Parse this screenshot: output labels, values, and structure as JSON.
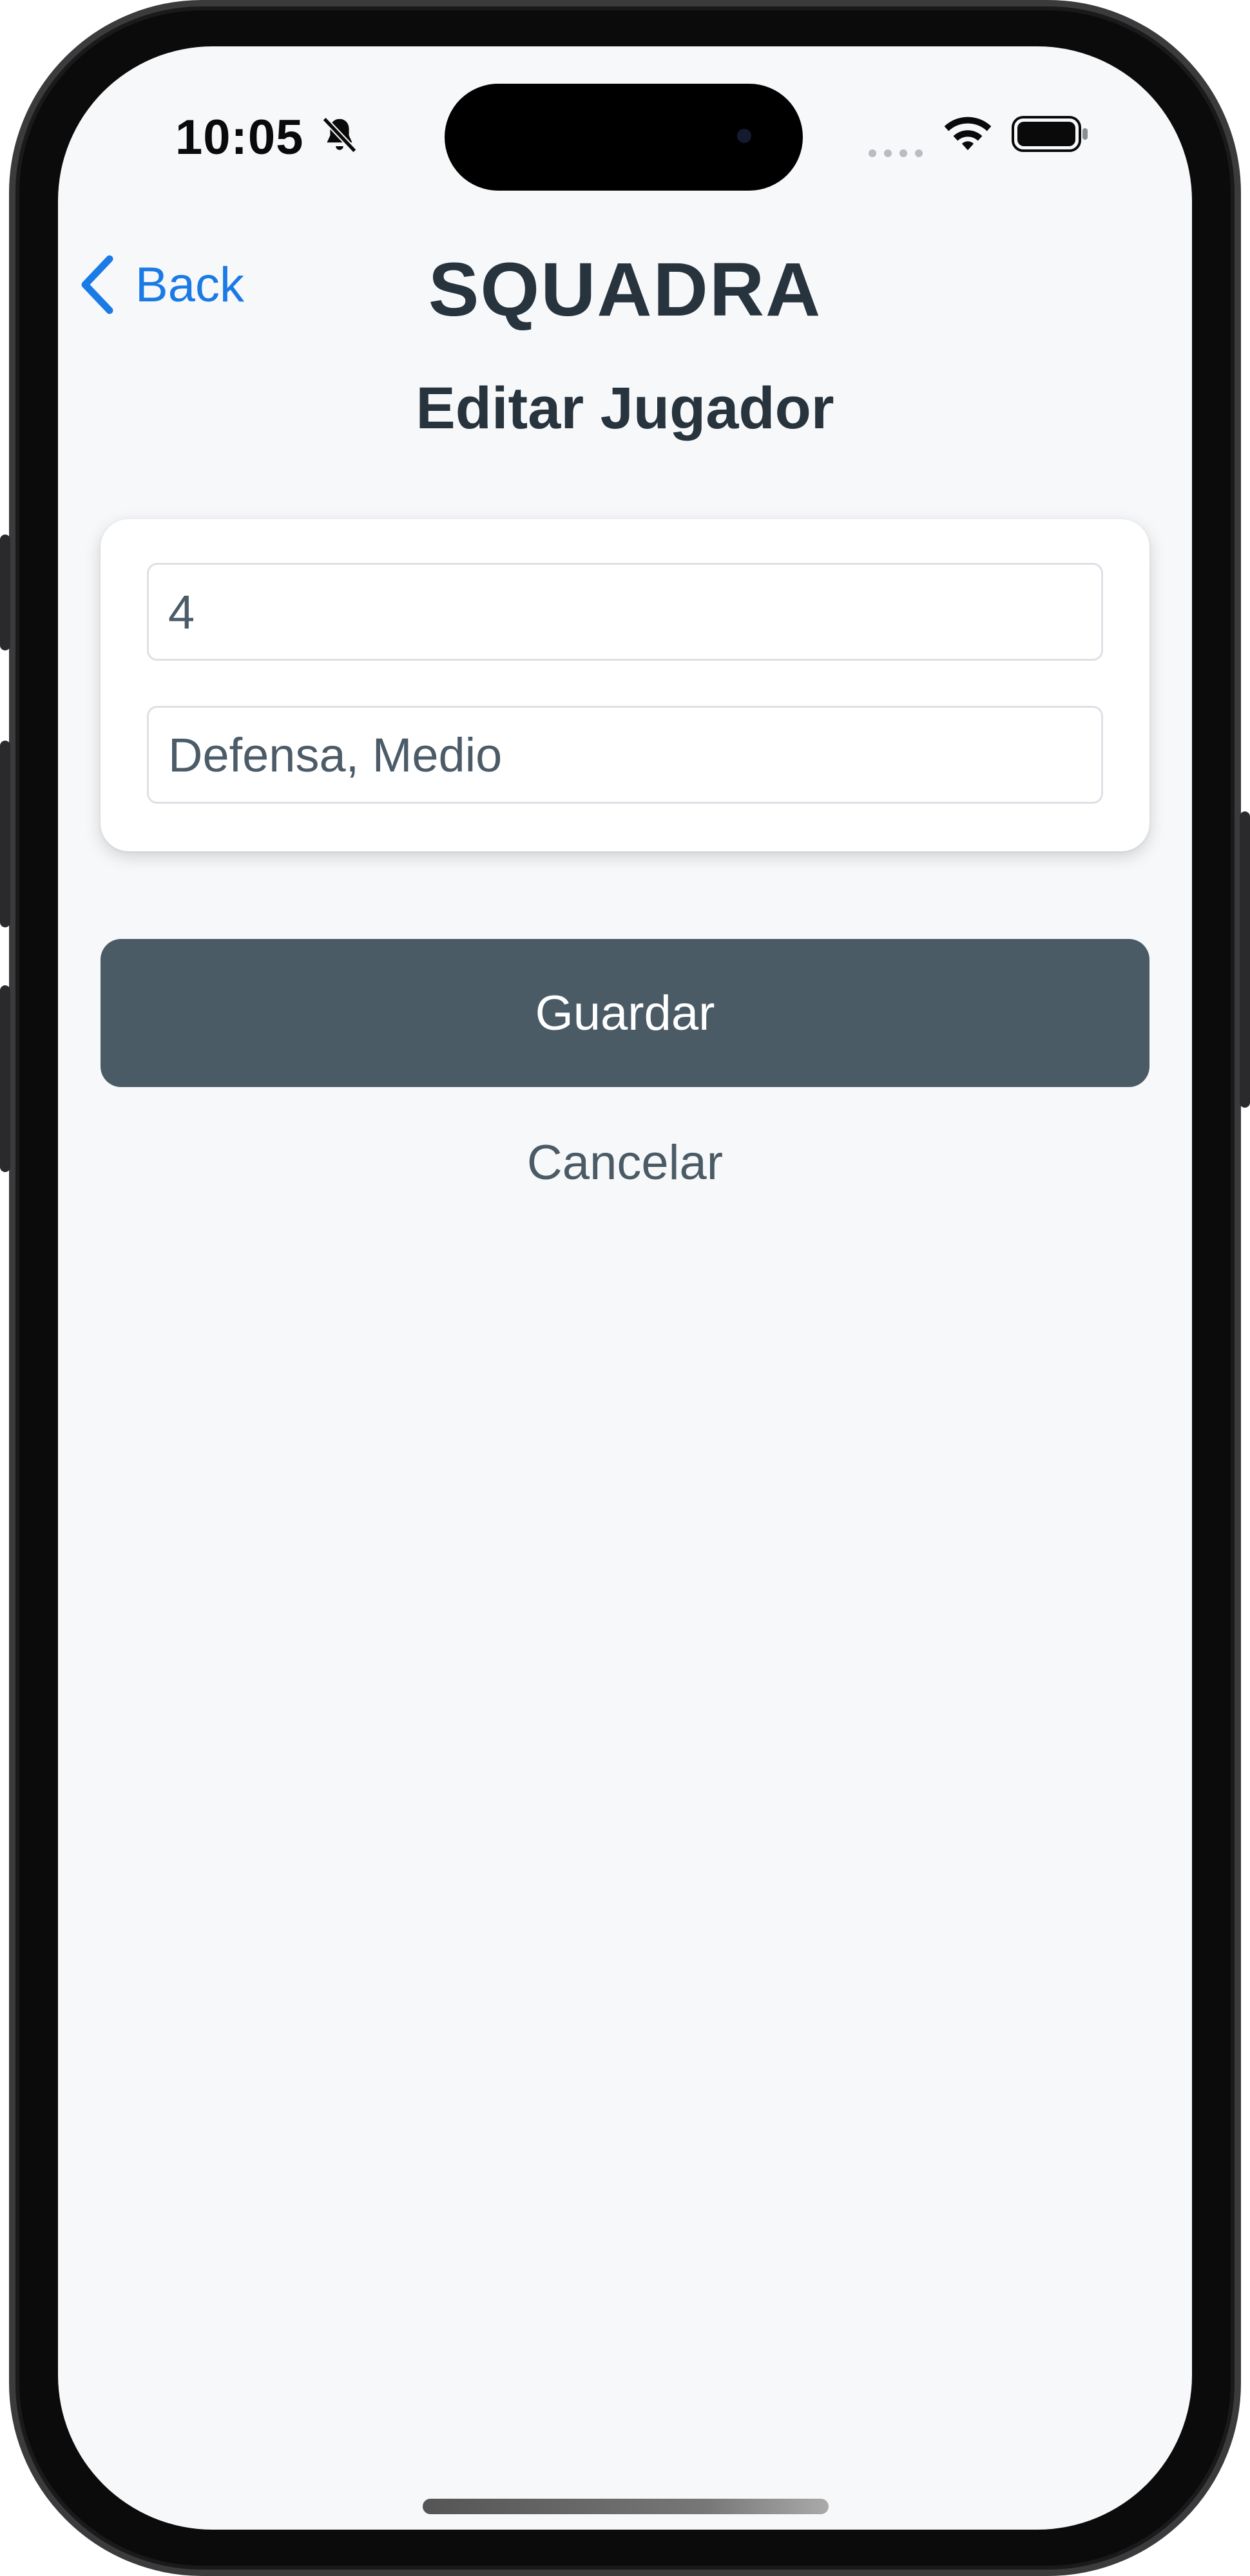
{
  "status_bar": {
    "time": "10:05",
    "icons": [
      "bell-slash-icon",
      "signal-icon",
      "wifi-icon",
      "battery-icon"
    ]
  },
  "nav": {
    "back_label": "Back",
    "app_title": "SQUADRA"
  },
  "page": {
    "title": "Editar Jugador"
  },
  "form": {
    "number_value": "4",
    "position_value": "Defensa, Medio"
  },
  "actions": {
    "save_label": "Guardar",
    "cancel_label": "Cancelar"
  },
  "colors": {
    "accent": "#1a7ae6",
    "primary_button": "#4a5b66",
    "title_text": "#27333d",
    "background": "#f7f8fa"
  }
}
